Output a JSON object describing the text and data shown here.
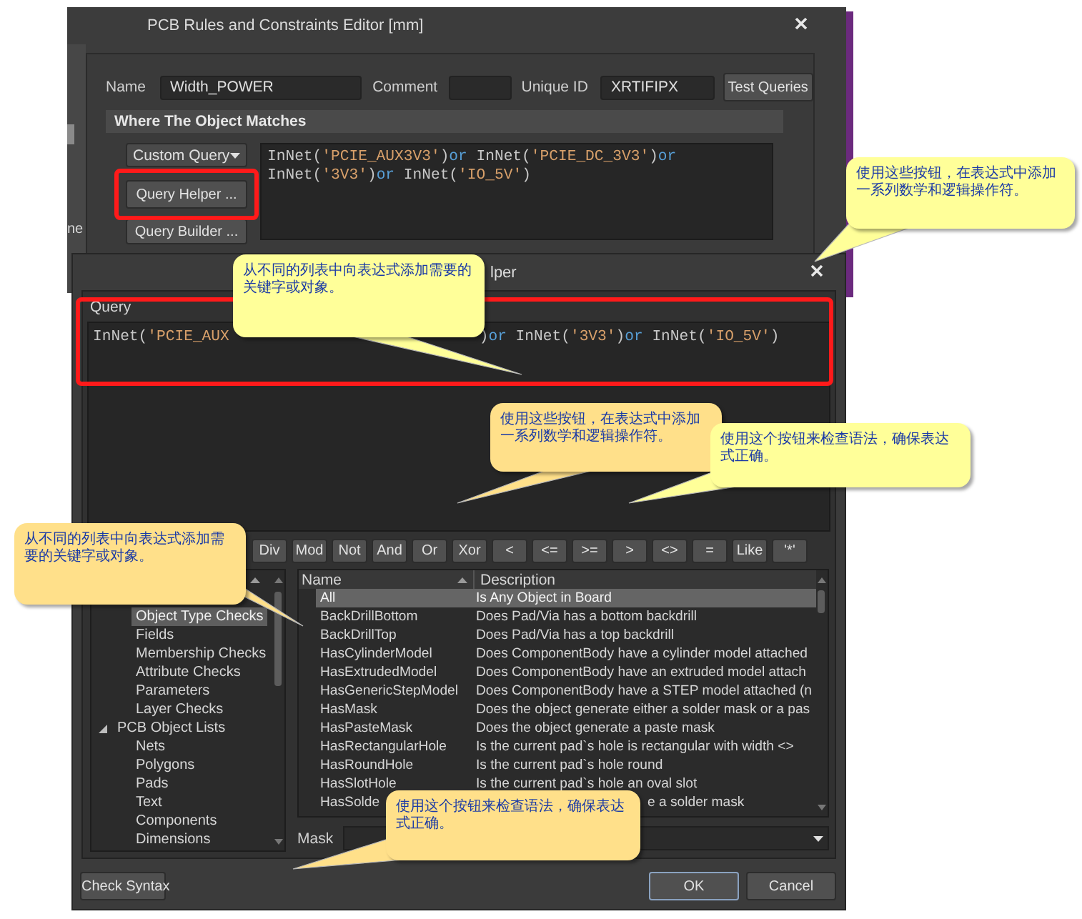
{
  "editor": {
    "title": "PCB Rules and Constraints Editor [mm]",
    "side_text": "ne",
    "name_label": "Name",
    "name_value": "Width_POWER",
    "comment_label": "Comment",
    "unique_id_label": "Unique ID",
    "unique_id_value": "XRTIFIPX",
    "test_button": "Test Queries",
    "section_title": "Where The Object Matches",
    "query_type": "Custom Query",
    "helper_button": "Query Helper ...",
    "builder_button": "Query Builder ...",
    "query_lines": [
      [
        {
          "kind": "plain",
          "text": "InNet("
        },
        {
          "kind": "string",
          "text": "'PCIE_AUX3V3'"
        },
        {
          "kind": "plain",
          "text": ")"
        },
        {
          "kind": "keyword",
          "text": "or"
        },
        {
          "kind": "plain",
          "text": " InNet("
        },
        {
          "kind": "string",
          "text": "'PCIE_DC_3V3'"
        },
        {
          "kind": "plain",
          "text": ")"
        },
        {
          "kind": "keyword",
          "text": "or"
        }
      ],
      [
        {
          "kind": "plain",
          "text": "InNet("
        },
        {
          "kind": "string",
          "text": "'3V3'"
        },
        {
          "kind": "plain",
          "text": ")"
        },
        {
          "kind": "keyword",
          "text": "or"
        },
        {
          "kind": "plain",
          "text": " InNet("
        },
        {
          "kind": "string",
          "text": "'IO_5V'"
        },
        {
          "kind": "plain",
          "text": ")"
        }
      ]
    ]
  },
  "helper": {
    "title": "lper",
    "query_label": "Query",
    "query_parts": [
      [
        {
          "kind": "plain",
          "text": "InNet("
        },
        {
          "kind": "string",
          "text": "'PCIE_AUX"
        }
      ],
      [
        {
          "kind": "plain",
          "text": ")"
        },
        {
          "kind": "keyword",
          "text": "or"
        },
        {
          "kind": "plain",
          "text": " InNet("
        },
        {
          "kind": "string",
          "text": "'3V3'"
        },
        {
          "kind": "plain",
          "text": ")"
        },
        {
          "kind": "keyword",
          "text": "or"
        },
        {
          "kind": "plain",
          "text": " InNet("
        },
        {
          "kind": "string",
          "text": "'IO_5V'"
        },
        {
          "kind": "plain",
          "text": ")"
        }
      ]
    ],
    "operators": [
      "Div",
      "Mod",
      "Not",
      "And",
      "Or",
      "Xor",
      "<",
      "<=",
      ">=",
      ">",
      "<>",
      "=",
      "Like",
      "'*'"
    ],
    "tree": [
      {
        "children": [
          {
            "label": "Object Type Checks",
            "selected": true
          },
          {
            "label": "Fields",
            "selected": false
          },
          {
            "label": "Membership Checks",
            "selected": false
          },
          {
            "label": "Attribute Checks",
            "selected": false
          },
          {
            "label": "Parameters",
            "selected": false
          },
          {
            "label": "Layer Checks",
            "selected": false
          }
        ]
      },
      {
        "label": "PCB Object Lists",
        "selected": false,
        "expanded": true,
        "children": [
          {
            "label": "Nets",
            "selected": false
          },
          {
            "label": "Polygons",
            "selected": false
          },
          {
            "label": "Pads",
            "selected": false
          },
          {
            "label": "Text",
            "selected": false
          },
          {
            "label": "Components",
            "selected": false
          },
          {
            "label": "Dimensions",
            "selected": false
          }
        ]
      }
    ],
    "table": {
      "columns": [
        "Name",
        "Description"
      ],
      "rows": [
        {
          "name": "All",
          "description": "Is Any Object in Board",
          "selected": true
        },
        {
          "name": "BackDrillBottom",
          "description": "Does Pad/Via has a bottom backdrill",
          "selected": false
        },
        {
          "name": "BackDrillTop",
          "description": "Does Pad/Via has a top backdrill",
          "selected": false
        },
        {
          "name": "HasCylinderModel",
          "description": "Does ComponentBody have a cylinder model attached",
          "selected": false
        },
        {
          "name": "HasExtrudedModel",
          "description": "Does ComponentBody have an extruded model attach",
          "selected": false
        },
        {
          "name": "HasGenericStepModel",
          "description": "Does ComponentBody have a STEP model attached (n",
          "selected": false
        },
        {
          "name": "HasMask",
          "description": "Does the object generate either a solder mask or a pas",
          "selected": false
        },
        {
          "name": "HasPasteMask",
          "description": "Does the object generate a paste mask",
          "selected": false
        },
        {
          "name": "HasRectangularHole",
          "description": "Is the current pad`s hole is rectangular with width <>",
          "selected": false
        },
        {
          "name": "HasRoundHole",
          "description": "Is the current pad`s hole round",
          "selected": false
        },
        {
          "name": "HasSlotHole",
          "description": "Is the current pad`s hole an oval slot",
          "selected": false
        },
        {
          "name": "HasSolde",
          "description": "e a solder mask",
          "selected": false
        }
      ]
    },
    "mask_label": "Mask",
    "check_button": "Check Syntax",
    "ok_button": "OK",
    "cancel_button": "Cancel"
  },
  "callouts": [
    {
      "text": "从不同的列表中向表达式添加需要的关键字或对象。",
      "color": "#ffff99"
    },
    {
      "text": "使用这些按钮，在表达式中添加一系列数学和逻辑操作符。",
      "color": "#ffff99"
    },
    {
      "text": "使用这些按钮，在表达式中添加一系列数学和逻辑操作符。",
      "color": "#ffe08a"
    },
    {
      "text": "使用这个按钮来检查语法，确保表达式正确。",
      "color": "#ffff99"
    },
    {
      "text": "从不同的列表中向表达式添加需要的关键字或对象。",
      "color": "#ffe08a"
    },
    {
      "text": "使用这个按钮来检查语法，确保表达式正确。",
      "color": "#ffe08a"
    }
  ]
}
